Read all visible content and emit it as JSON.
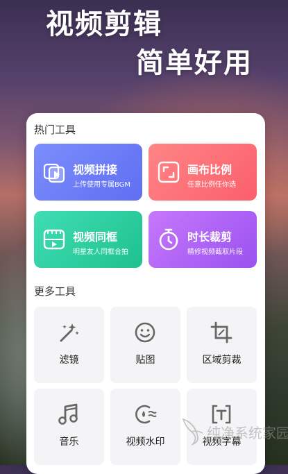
{
  "hero": {
    "line1": "视频剪辑",
    "line2": "简单好用"
  },
  "hot_tools": {
    "title": "热门工具",
    "items": [
      {
        "title": "视频拼接",
        "subtitle": "上传使用专属BGM",
        "icon": "video-splice-icon",
        "color": "#6f7ef8"
      },
      {
        "title": "画布比例",
        "subtitle": "任意比例任你选",
        "icon": "canvas-ratio-icon",
        "color": "#fd6c77"
      },
      {
        "title": "视频同框",
        "subtitle": "明星友人同框合拍",
        "icon": "video-duet-icon",
        "color": "#2fd1a2"
      },
      {
        "title": "时长裁剪",
        "subtitle": "精修视频截取片段",
        "icon": "stopwatch-icon",
        "color": "#b065f5"
      }
    ]
  },
  "more_tools": {
    "title": "更多工具",
    "items": [
      {
        "label": "滤镜",
        "icon": "magic-wand-icon"
      },
      {
        "label": "贴图",
        "icon": "sticker-icon"
      },
      {
        "label": "区域剪裁",
        "icon": "crop-icon"
      },
      {
        "label": "音乐",
        "icon": "music-note-icon"
      },
      {
        "label": "视频水印",
        "icon": "watermark-icon"
      },
      {
        "label": "视频字幕",
        "icon": "subtitle-icon"
      }
    ]
  },
  "watermark": {
    "text": "纯净系统家园"
  }
}
